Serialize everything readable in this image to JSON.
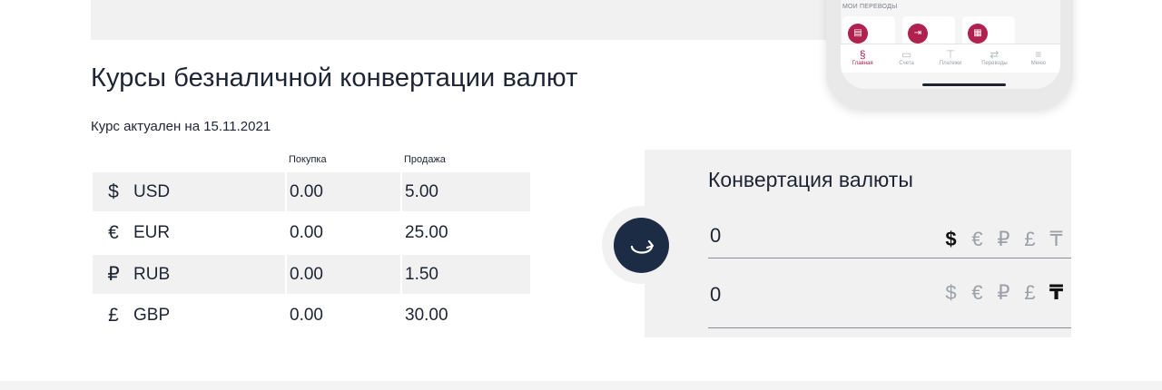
{
  "title": "Курсы безналичной конвертации валют",
  "date_note": "Курс актуален на 15.11.2021",
  "rates": {
    "headers": {
      "buy": "Покупка",
      "sell": "Продажа"
    },
    "rows": [
      {
        "symbol": "$",
        "code": "USD",
        "buy": "0.00",
        "sell": "5.00"
      },
      {
        "symbol": "€",
        "code": "EUR",
        "buy": "0.00",
        "sell": "25.00"
      },
      {
        "symbol": "₽",
        "code": "RUB",
        "buy": "0.00",
        "sell": "1.50"
      },
      {
        "symbol": "£",
        "code": "GBP",
        "buy": "0.00",
        "sell": "30.00"
      }
    ]
  },
  "converter": {
    "title": "Конвертация валюты",
    "from": {
      "value": "0",
      "currencies": [
        "$",
        "€",
        "₽",
        "£",
        "₸"
      ],
      "selected": "$"
    },
    "to": {
      "value": "0",
      "currencies": [
        "$",
        "€",
        "₽",
        "£",
        "₸"
      ],
      "selected": "₸"
    },
    "swap_icon": "swap-arrow-icon"
  },
  "phone": {
    "section_label": "МОИ ПЕРЕВОДЫ",
    "cards": [
      {
        "icon": "contact-card-icon",
        "glyph": "▤"
      },
      {
        "icon": "transfer-card-icon",
        "glyph": "⇥"
      },
      {
        "icon": "document-icon",
        "glyph": "▦"
      }
    ],
    "nav": [
      {
        "label": "Главная",
        "glyph": "§",
        "icon": "home-icon",
        "active": true
      },
      {
        "label": "Счета",
        "glyph": "▭",
        "icon": "card-icon",
        "active": false
      },
      {
        "label": "Платежи",
        "glyph": "⊤",
        "icon": "tenge-circle-icon",
        "active": false
      },
      {
        "label": "Переводы",
        "glyph": "⇄",
        "icon": "transfer-icon",
        "active": false
      },
      {
        "label": "Меню",
        "glyph": "≡",
        "icon": "menu-icon",
        "active": false
      }
    ],
    "accent_color": "#b0214f"
  },
  "colors": {
    "text": "#1d2433",
    "swap_button": "#1d2c45",
    "panel": "#f1f1f1"
  }
}
